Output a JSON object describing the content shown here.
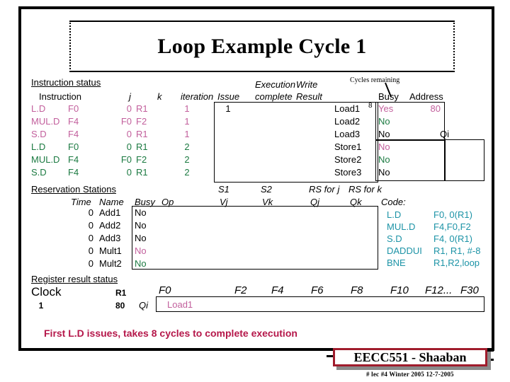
{
  "title": "Loop Example Cycle 1",
  "instruction_status": {
    "section_label": "Instruction status",
    "headers": {
      "instruction": "Instruction",
      "j": "j",
      "k": "k",
      "iteration": "iteration",
      "issue": "Issue",
      "execution_complete_line1": "Execution",
      "execution_complete_line2": "complete",
      "write_result_line1": "Write",
      "write_result_line2": "Result"
    },
    "rows": [
      {
        "instruction": "L.D",
        "dest": "F0",
        "j": "0",
        "k": "R1",
        "iteration": "1",
        "issue": "1",
        "exec_complete": "",
        "write_result": "",
        "color": "pink"
      },
      {
        "instruction": "MUL.D",
        "dest": "F4",
        "j": "F0",
        "k": "F2",
        "iteration": "1",
        "issue": "",
        "exec_complete": "",
        "write_result": "",
        "color": "pink"
      },
      {
        "instruction": "S.D",
        "dest": "F4",
        "j": "0",
        "k": "R1",
        "iteration": "1",
        "issue": "",
        "exec_complete": "",
        "write_result": "",
        "color": "pink"
      },
      {
        "instruction": "L.D",
        "dest": "F0",
        "j": "0",
        "k": "R1",
        "iteration": "2",
        "issue": "",
        "exec_complete": "",
        "write_result": "",
        "color": "green"
      },
      {
        "instruction": "MUL.D",
        "dest": "F4",
        "j": "F0",
        "k": "F2",
        "iteration": "2",
        "issue": "",
        "exec_complete": "",
        "write_result": "",
        "color": "green"
      },
      {
        "instruction": "S.D",
        "dest": "F4",
        "j": "0",
        "k": "R1",
        "iteration": "2",
        "issue": "",
        "exec_complete": "",
        "write_result": "",
        "color": "green"
      }
    ]
  },
  "load_store_units": {
    "annotation": "Cycles remaining",
    "headers": {
      "busy": "Busy",
      "address": "Address",
      "qi": "Qi"
    },
    "rows": [
      {
        "name": "Load1",
        "cycles": "8",
        "busy": "Yes",
        "address": "80",
        "qi": "",
        "color": "pink"
      },
      {
        "name": "Load2",
        "cycles": "",
        "busy": "No",
        "address": "",
        "qi": "",
        "color": "green"
      },
      {
        "name": "Load3",
        "cycles": "",
        "busy": "No",
        "address": "",
        "qi": "",
        "color": "black"
      },
      {
        "name": "Store1",
        "cycles": "",
        "busy": "No",
        "address": "",
        "qi": "",
        "color": "pink"
      },
      {
        "name": "Store2",
        "cycles": "",
        "busy": "No",
        "address": "",
        "qi": "",
        "color": "green"
      },
      {
        "name": "Store3",
        "cycles": "",
        "busy": "No",
        "address": "",
        "qi": "",
        "color": "black"
      }
    ]
  },
  "reservation_stations": {
    "section_label": "Reservation Stations",
    "headers": {
      "time": "Time",
      "name": "Name",
      "busy": "Busy",
      "op": "Op",
      "s1": "S1",
      "s2": "S2",
      "vj": "Vj",
      "vk": "Vk",
      "rs_for_j": "RS for j",
      "rs_for_k": "RS for k",
      "qj": "Qj",
      "qk": "Qk"
    },
    "rows": [
      {
        "time": "0",
        "name": "Add1",
        "busy": "No",
        "op": "",
        "vj": "",
        "vk": "",
        "qj": "",
        "qk": "",
        "color": "black"
      },
      {
        "time": "0",
        "name": "Add2",
        "busy": "No",
        "op": "",
        "vj": "",
        "vk": "",
        "qj": "",
        "qk": "",
        "color": "black"
      },
      {
        "time": "0",
        "name": "Add3",
        "busy": "No",
        "op": "",
        "vj": "",
        "vk": "",
        "qj": "",
        "qk": "",
        "color": "black"
      },
      {
        "time": "0",
        "name": "Mult1",
        "busy": "No",
        "op": "",
        "vj": "",
        "vk": "",
        "qj": "",
        "qk": "",
        "color": "pink"
      },
      {
        "time": "0",
        "name": "Mult2",
        "busy": "No",
        "op": "",
        "vj": "",
        "vk": "",
        "qj": "",
        "qk": "",
        "color": "green"
      }
    ]
  },
  "code": {
    "label": "Code:",
    "lines": [
      {
        "op": "L.D",
        "operands": "F0, 0(R1)"
      },
      {
        "op": "MUL.D",
        "operands": "F4,F0,F2"
      },
      {
        "op": "S.D",
        "operands": "F4, 0(R1)"
      },
      {
        "op": "DADDUI",
        "operands": "R1, R1, #-8"
      },
      {
        "op": "BNE",
        "operands": "R1,R2,loop"
      }
    ]
  },
  "register_result_status": {
    "section_label": "Register result status",
    "clock_label": "Clock",
    "clock_value": "1",
    "r1_label": "R1",
    "r1_value": "80",
    "qi_label": "Qi",
    "registers": [
      "F0",
      "F2",
      "F4",
      "F6",
      "F8",
      "F10",
      "F12...",
      "F30"
    ],
    "values": [
      {
        "register": "F0",
        "value": "Load1",
        "color": "pink"
      }
    ]
  },
  "caption": "First L.D issues,  takes 8 cycles to complete execution",
  "badge": "EECC551 - Shaaban",
  "footnote": "#  lec #4  Winter 2005   12-7-2005",
  "colors": {
    "pink": "#c25f9c",
    "green": "#1b7a41",
    "teal": "#1c93a6",
    "caption": "#b5174a",
    "badge_border": "#a01c2c"
  }
}
